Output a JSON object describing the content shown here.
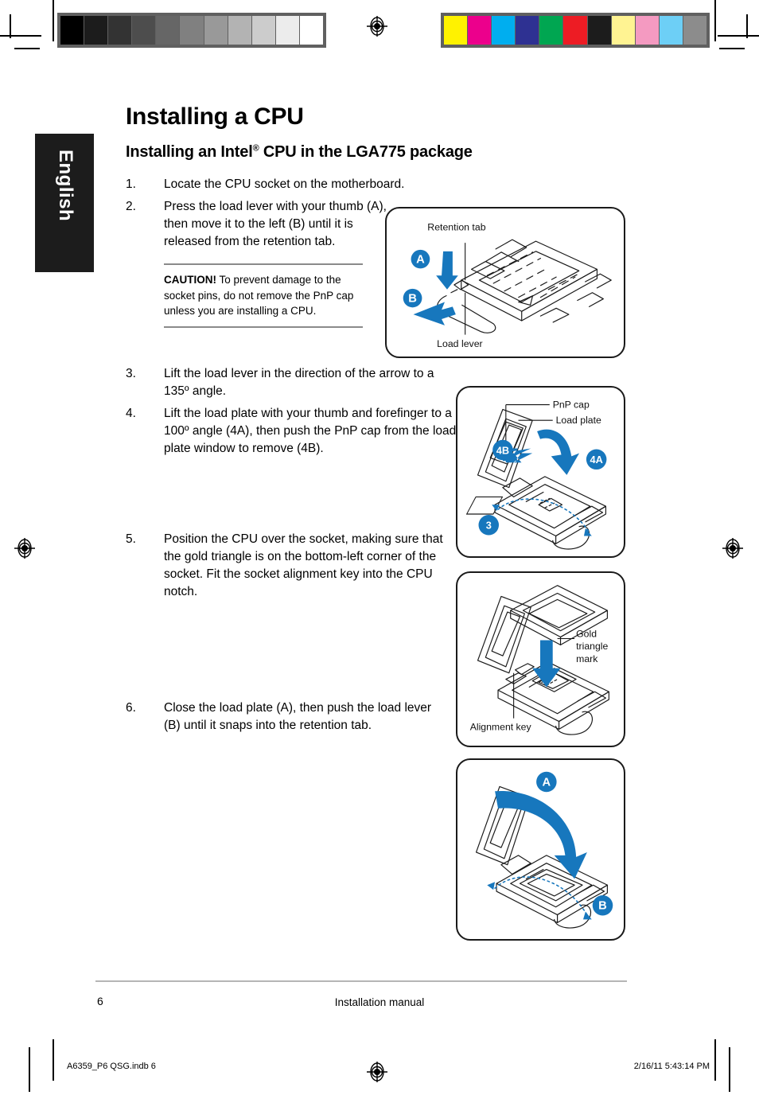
{
  "document": {
    "language_tab": "English",
    "title": "Installing a CPU",
    "subtitle_before": "Installing an Intel",
    "subtitle_mark": "®",
    "subtitle_after": " CPU in the LGA775 package"
  },
  "steps": [
    {
      "num": "1.",
      "text": "Locate the CPU socket on the motherboard."
    },
    {
      "num": "2.",
      "text": "Press the load lever with your thumb (A), then move it to the left (B) until it is released from the retention tab."
    },
    {
      "num": "3.",
      "text": "Lift the load lever in the direction of the arrow to a 135º angle."
    },
    {
      "num": "4.",
      "text": "Lift the load plate with your thumb and forefinger to a 100º angle (4A), then push the PnP cap from the load plate window to remove (4B)."
    },
    {
      "num": "5.",
      "text": "Position the CPU over the socket, making sure that the gold triangle is on the bottom-left corner of the socket. Fit the socket alignment key into the CPU notch."
    },
    {
      "num": "6.",
      "text": "Close the load plate (A), then push the load lever (B) until it snaps into the retention tab."
    }
  ],
  "caution": {
    "label": "CAUTION!",
    "text": " To prevent damage to the socket pins, do not remove the PnP cap unless you are installing a CPU."
  },
  "figures": {
    "fig1": {
      "label_retention_tab": "Retention tab",
      "label_load_lever": "Load lever",
      "badge_a": "A",
      "badge_b": "B"
    },
    "fig2": {
      "label_pnp_cap": "PnP cap",
      "label_load_plate": "Load plate",
      "badge_3": "3",
      "badge_4a": "4A",
      "badge_4b": "4B"
    },
    "fig3": {
      "label_gold_1": "Gold",
      "label_gold_2": "triangle",
      "label_gold_3": "mark",
      "label_alignment_key": "Alignment key"
    },
    "fig4": {
      "badge_a": "A",
      "badge_b": "B"
    }
  },
  "footer": {
    "page_number": "6",
    "center_text": "Installation manual",
    "print_file": "A6359_P6 QSG.indb   6",
    "print_timestamp": "2/16/11   5:43:14 PM"
  },
  "colors": {
    "accent_blue": "#1777bd",
    "accent_blue_dark": "#0f63a8",
    "tab_black": "#1c1c1c",
    "rule_gray": "#8a8a8a",
    "footer_rule": "#b5b5b5"
  },
  "calibration": {
    "gray_ramp": [
      "#000000",
      "#1c1c1c",
      "#333333",
      "#4d4d4d",
      "#666666",
      "#808080",
      "#999999",
      "#b3b3b3",
      "#cccccc",
      "#ececec",
      "#ffffff"
    ],
    "color_bar": [
      "#fff200",
      "#ec008c",
      "#00aeef",
      "#2e3192",
      "#00a651",
      "#ed1c24",
      "#1c1c1c",
      "#fff392",
      "#f49ac1",
      "#6dcff6",
      "#8c8c8c"
    ]
  }
}
